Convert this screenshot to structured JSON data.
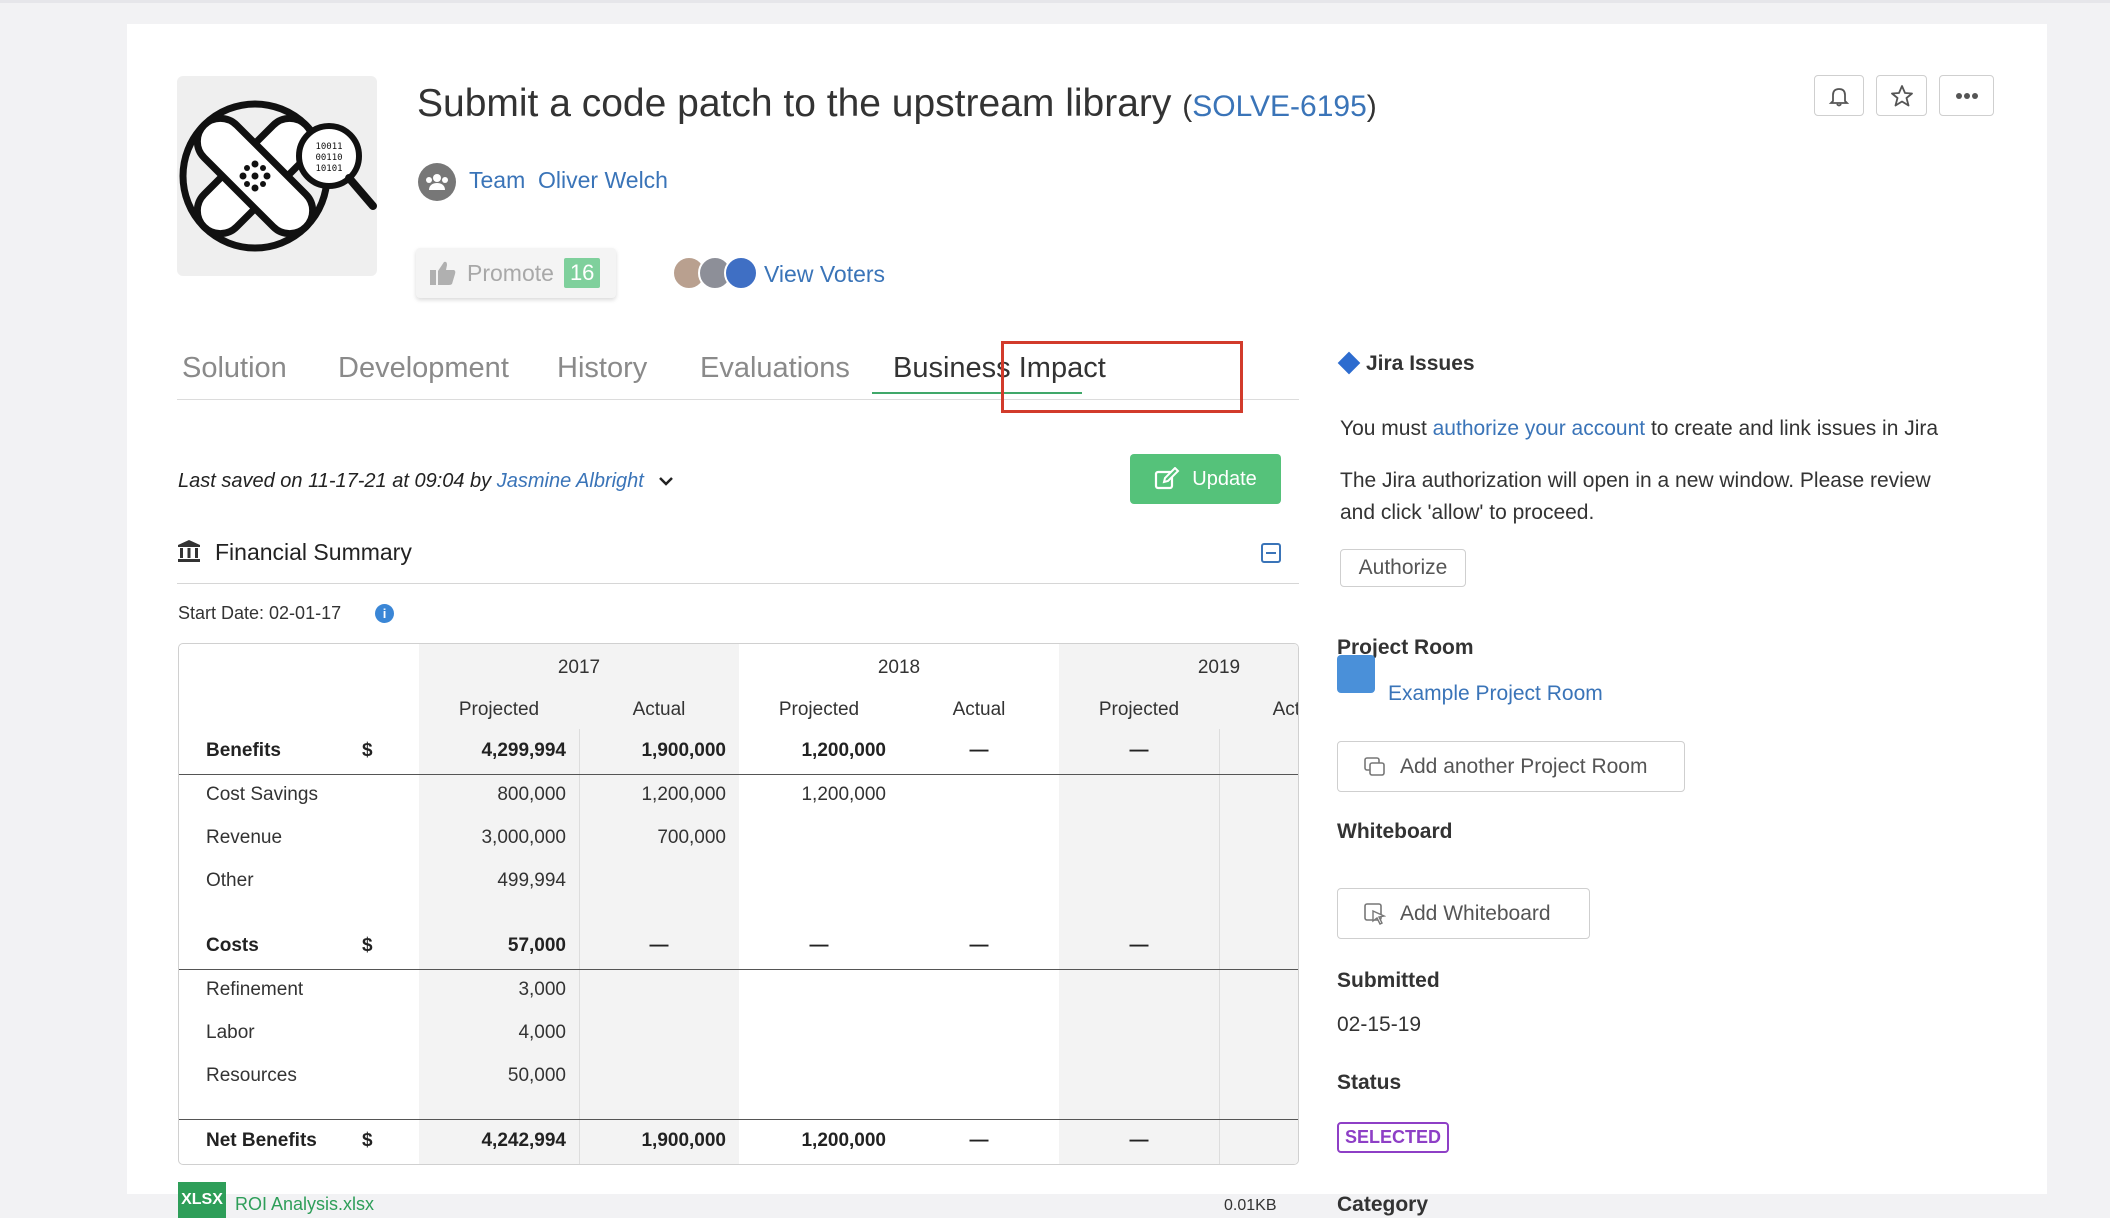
{
  "header": {
    "title": "Submit a code patch to the upstream library",
    "paren_open": "(",
    "issue_key": "SOLVE-6195",
    "paren_close": ")",
    "team_label": "Team",
    "team_name": "Oliver Welch",
    "promote_label": "Promote",
    "promote_count": "16",
    "view_voters": "View Voters",
    "logo_binary": [
      "10011",
      "00110",
      "10101"
    ]
  },
  "tabs": [
    {
      "label": "Solution"
    },
    {
      "label": "Development"
    },
    {
      "label": "History"
    },
    {
      "label": "Evaluations"
    },
    {
      "label": "Business Impact",
      "active": true
    }
  ],
  "saved": {
    "prefix": "Last saved on 11-17-21 at 09:04 by",
    "user": "Jasmine Albright"
  },
  "update_label": "Update",
  "financial": {
    "title": "Financial Summary",
    "start_date": "Start Date: 02-01-17",
    "years": [
      "2017",
      "2018",
      "2019"
    ],
    "subheaders": [
      "Projected",
      "Actual",
      "Projected",
      "Actual",
      "Projected",
      "Actual"
    ],
    "dash": "—",
    "currency": "$",
    "rows": {
      "benefits": {
        "label": "Benefits",
        "values": [
          "4,299,994",
          "1,900,000",
          "1,200,000",
          "—",
          "—"
        ]
      },
      "cost_savings": {
        "label": "Cost Savings",
        "values": [
          "800,000",
          "1,200,000",
          "1,200,000"
        ]
      },
      "revenue": {
        "label": "Revenue",
        "values": [
          "3,000,000",
          "700,000"
        ]
      },
      "other": {
        "label": "Other",
        "values": [
          "499,994"
        ]
      },
      "costs": {
        "label": "Costs",
        "values": [
          "57,000",
          "—",
          "—",
          "—",
          "—"
        ]
      },
      "refinement": {
        "label": "Refinement",
        "values": [
          "3,000"
        ]
      },
      "labor": {
        "label": "Labor",
        "values": [
          "4,000"
        ]
      },
      "resources": {
        "label": "Resources",
        "values": [
          "50,000"
        ]
      },
      "net_benefits": {
        "label": "Net Benefits",
        "values": [
          "4,242,994",
          "1,900,000",
          "1,200,000",
          "—",
          "—"
        ]
      }
    }
  },
  "attachment": {
    "type": "XLSX",
    "name": "ROI Analysis.xlsx",
    "size": "0.01KB"
  },
  "sidebar": {
    "jira_title": "Jira Issues",
    "jira_text_pre": "You must",
    "jira_link": "authorize your account",
    "jira_text_post": "to create and link issues in Jira",
    "jira_note_1": "The Jira authorization will open in a new window. Please review",
    "jira_note_2": "and click 'allow' to proceed.",
    "authorize_label": "Authorize",
    "project_room_title": "Project Room",
    "project_room_link": "Example Project Room",
    "add_room_label": "Add another Project Room",
    "whiteboard_title": "Whiteboard",
    "add_whiteboard_label": "Add Whiteboard",
    "submitted_title": "Submitted",
    "submitted_value": "02-15-19",
    "status_title": "Status",
    "status_value": "SELECTED",
    "category_title": "Category"
  },
  "colors": {
    "link": "#3a74b8",
    "accent_green": "#55c27a",
    "status_purple": "#8e3fc6",
    "highlight_red": "#d23b2b"
  }
}
